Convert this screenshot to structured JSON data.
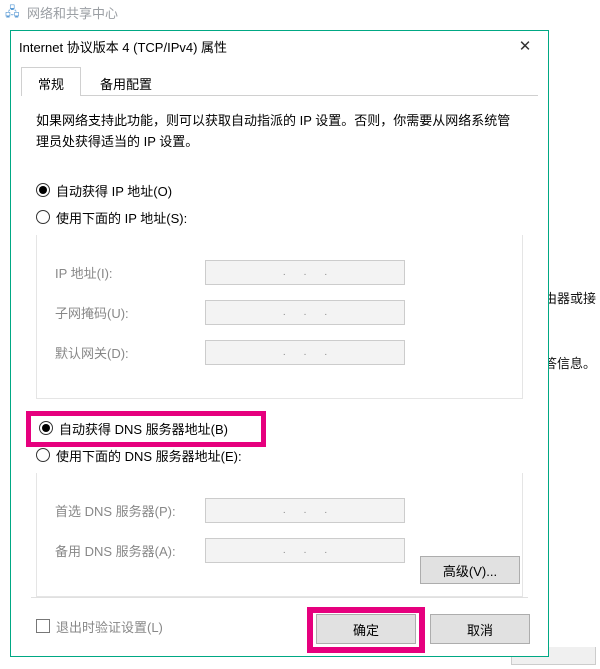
{
  "bg": {
    "title": "网络和共享中心",
    "side1": "置路由器或接",
    "side2": "解答信息。"
  },
  "dialog": {
    "title": "Internet 协议版本 4 (TCP/IPv4) 属性",
    "tabs": {
      "general": "常规",
      "alternate": "备用配置"
    },
    "intro": "如果网络支持此功能，则可以获取自动指派的 IP 设置。否则，你需要从网络系统管理员处获得适当的 IP 设置。",
    "ip": {
      "auto": "自动获得 IP 地址(O)",
      "manual": "使用下面的 IP 地址(S):",
      "addr": "IP 地址(I):",
      "mask": "子网掩码(U):",
      "gateway": "默认网关(D):"
    },
    "dns": {
      "auto": "自动获得 DNS 服务器地址(B)",
      "manual": "使用下面的 DNS 服务器地址(E):",
      "preferred": "首选 DNS 服务器(P):",
      "alternate": "备用 DNS 服务器(A):"
    },
    "validate": "退出时验证设置(L)",
    "advanced": "高级(V)...",
    "ok": "确定",
    "cancel": "取消"
  }
}
